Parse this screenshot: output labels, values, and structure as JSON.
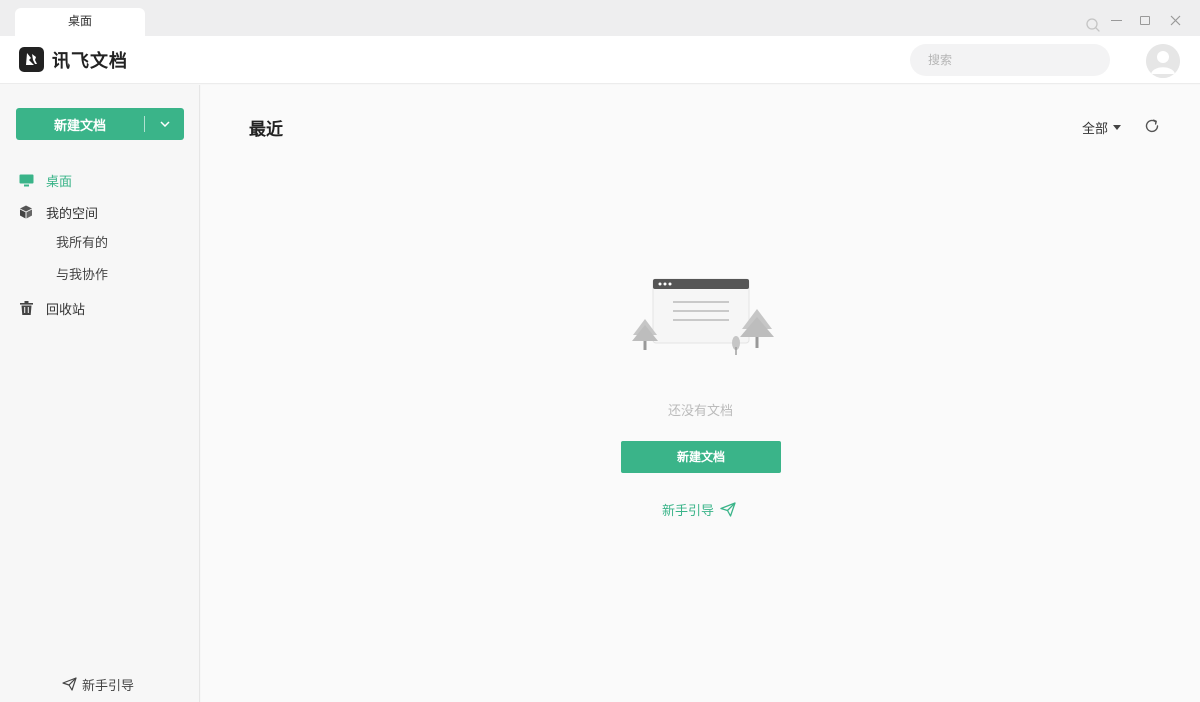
{
  "window": {
    "tab_label": "桌面"
  },
  "header": {
    "app_title": "讯飞文档",
    "search_placeholder": "搜索"
  },
  "sidebar": {
    "new_doc_label": "新建文档",
    "items": [
      {
        "label": "桌面",
        "icon": "monitor-icon",
        "active": true
      },
      {
        "label": "我的空间",
        "icon": "cube-icon",
        "active": false
      },
      {
        "label": "我所有的",
        "sub": true
      },
      {
        "label": "与我协作",
        "sub": true
      },
      {
        "label": "回收站",
        "icon": "trash-icon",
        "active": false
      }
    ],
    "guide_label": "新手引导"
  },
  "main": {
    "title": "最近",
    "filter_label": "全部",
    "empty_text": "还没有文档",
    "create_button_label": "新建文档",
    "guide_link_label": "新手引导"
  },
  "colors": {
    "accent": "#3ab489",
    "text_dark": "#222222",
    "empty_text": "#bbbbbb"
  }
}
